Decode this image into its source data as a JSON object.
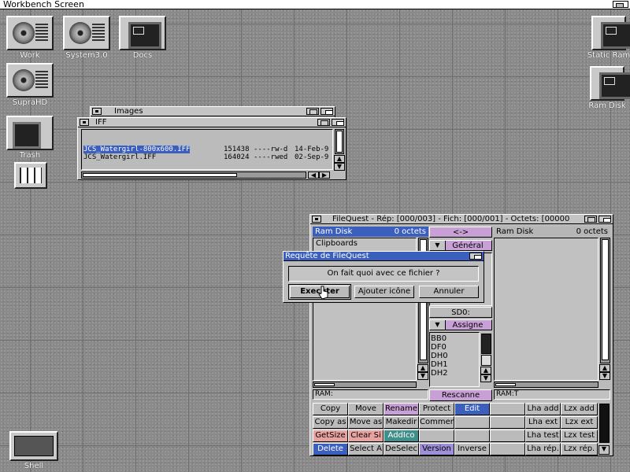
{
  "screen": {
    "title": "Workbench Screen"
  },
  "desktop_icons": {
    "work": "Work",
    "system": "System3.0",
    "docs": "Docs",
    "suprahd": "SupraHD",
    "trash": "Trash",
    "static_ram": "Static Ram",
    "ram_disk": "Ram Disk",
    "shell": "Shell"
  },
  "images_window": {
    "title": "Images"
  },
  "iff_window": {
    "title": "IFF",
    "files": [
      {
        "name": "JCS_Watergirl-800x600.IFF",
        "size": "151438",
        "prot": "----rw-d",
        "date": "14-Feb-9",
        "selected": true
      },
      {
        "name": "JCS_Watergirl.IFF",
        "size": "164024",
        "prot": "----rwed",
        "date": "02-Sep-9",
        "selected": false
      }
    ]
  },
  "filequest": {
    "title": "FileQuest - Rép: [000/003] - Fich: [000/001] - Octets: [00000",
    "left_panel": {
      "name": "Ram Disk",
      "count": "0 octets",
      "items": [
        "Clipboards"
      ]
    },
    "right_panel": {
      "name": "Ram Disk",
      "count": "0 octets"
    },
    "middle": {
      "swap": "<->",
      "general": "Général",
      "sd0": "SD0:",
      "assign": "Assigne",
      "volumes": [
        "BB0",
        "DF0",
        "DH0",
        "DH1",
        "DH2"
      ],
      "rescan": "Rescanne"
    },
    "left_path": "RAM:",
    "right_path": "RAM:T",
    "commands": [
      [
        "Copy",
        "Move",
        "Rename",
        "Protect",
        "Edit",
        "",
        "Lha add",
        "Lzx add"
      ],
      [
        "Copy as",
        "Move as",
        "Makedir",
        "Commen",
        "",
        "",
        "Lha ext",
        "Lzx ext"
      ],
      [
        "GetSize",
        "Clear Si",
        "AddIco",
        "",
        "",
        "",
        "Lha test",
        "Lzx test"
      ],
      [
        "Delete",
        "Select A",
        "DeSelec",
        "Version",
        "Inverse",
        "",
        "Lha rép.",
        "Lzx rép."
      ]
    ]
  },
  "requester": {
    "title": "Requête de FileQuest",
    "message": "On fait quoi avec ce fichier ?",
    "execute": "Executer",
    "add_icon": "Ajouter icône",
    "cancel": "Annuler"
  },
  "colors": {
    "selection_blue": "#3a5fbd",
    "pink": "#c9a0d6",
    "salmon": "#e8a3a0",
    "teal": "#3f8f8a",
    "violet": "#9e8fd8"
  }
}
